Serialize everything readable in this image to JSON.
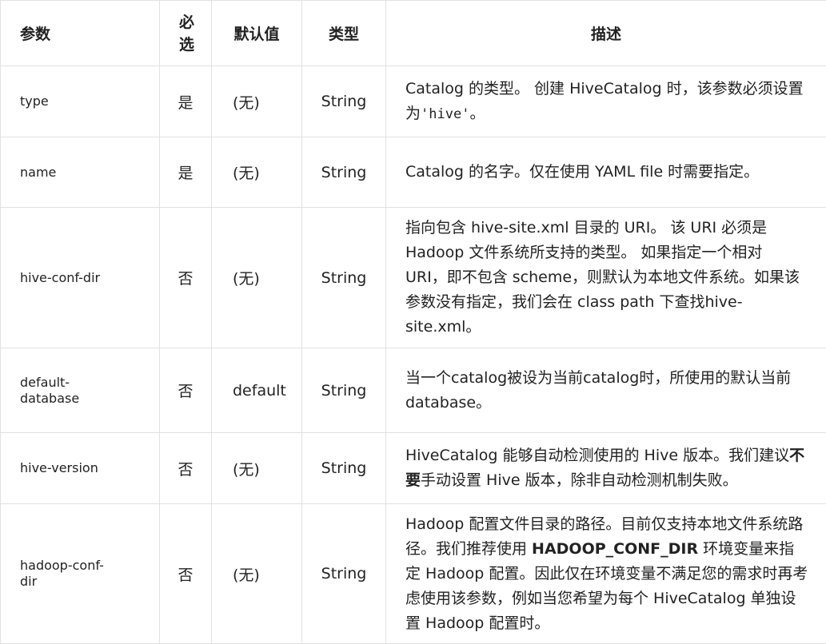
{
  "headers": {
    "param": "参数",
    "required_1": "必",
    "required_2": "选",
    "default": "默认值",
    "type": "类型",
    "desc": "描述"
  },
  "rows": [
    {
      "param": "type",
      "required": "是",
      "default": "(无)",
      "type": "String",
      "desc_a": "Catalog 的类型。 创建 HiveCatalog 时，该参数必须设置为",
      "desc_code": "'hive'",
      "desc_b": "。"
    },
    {
      "param": "name",
      "required": "是",
      "default": "(无)",
      "type": "String",
      "desc": "Catalog 的名字。仅在使用 YAML file 时需要指定。"
    },
    {
      "param": "hive-conf-dir",
      "required": "否",
      "default": "(无)",
      "type": "String",
      "desc": "指向包含 hive-site.xml 目录的 URI。 该 URI 必须是 Hadoop 文件系统所支持的类型。 如果指定一个相对 URI，即不包含 scheme，则默认为本地文件系统。如果该参数没有指定，我们会在 class path 下查找hive-site.xml。"
    },
    {
      "param_1": "default-",
      "param_2": "database",
      "required": "否",
      "default": "default",
      "type": "String",
      "desc": "当一个catalog被设为当前catalog时，所使用的默认当前database。"
    },
    {
      "param": "hive-version",
      "required": "否",
      "default": "(无)",
      "type": "String",
      "desc_a": "HiveCatalog 能够自动检测使用的 Hive 版本。我们建议",
      "desc_bold": "不要",
      "desc_b": "手动设置 Hive 版本，除非自动检测机制失败。"
    },
    {
      "param_1": "hadoop-conf-",
      "param_2": "dir",
      "required": "否",
      "default": "(无)",
      "type": "String",
      "desc_a": "Hadoop 配置文件目录的路径。目前仅支持本地文件系统路径。我们推荐使用 ",
      "desc_bold": "HADOOP_CONF_DIR",
      "desc_b": " 环境变量来指定 Hadoop 配置。因此仅在环境变量不满足您的需求时再考虑使用该参数，例如当您希望为每个 HiveCatalog 单独设置 Hadoop 配置时。"
    }
  ]
}
